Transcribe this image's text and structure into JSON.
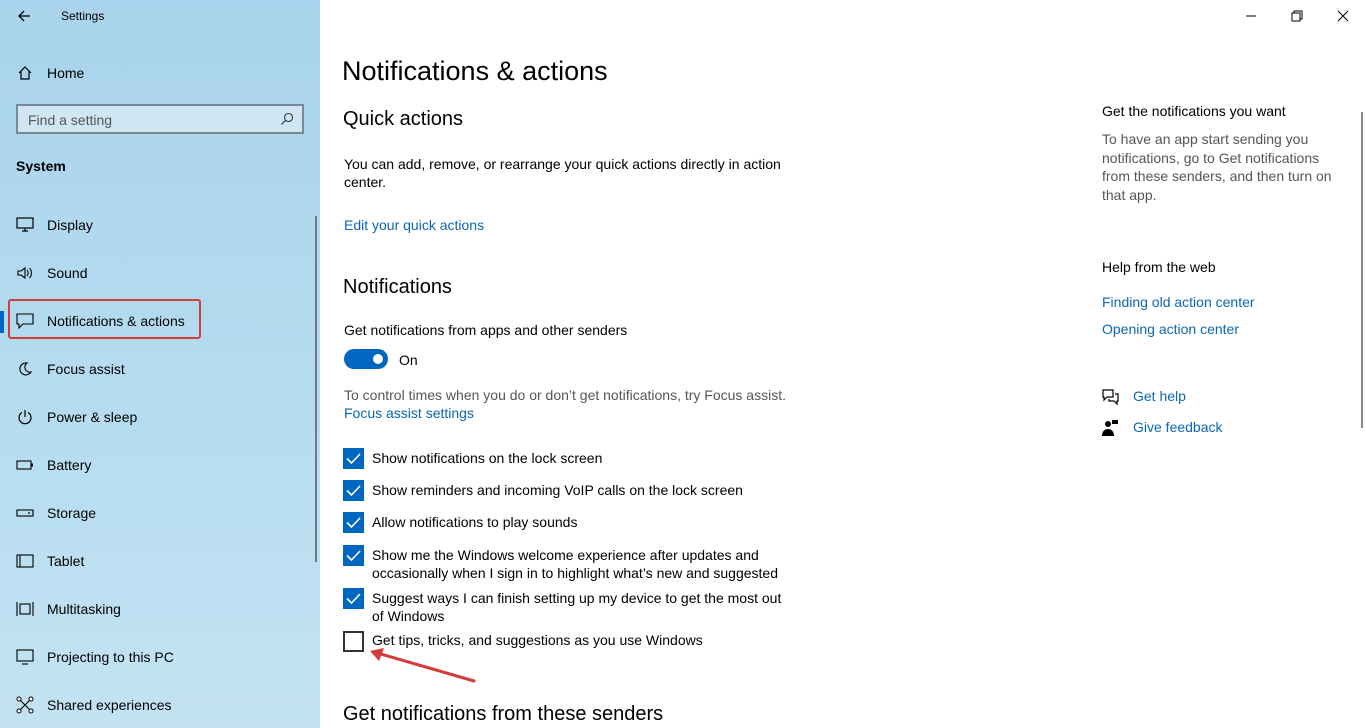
{
  "window": {
    "app_title": "Settings",
    "back_icon": "back-arrow-icon",
    "controls": [
      "minimize-icon",
      "restore-icon",
      "close-icon"
    ]
  },
  "sidebar": {
    "home_label": "Home",
    "search_placeholder": "Find a setting",
    "section_title": "System",
    "items": [
      {
        "label": "Display",
        "icon": "display-icon"
      },
      {
        "label": "Sound",
        "icon": "sound-icon"
      },
      {
        "label": "Notifications & actions",
        "icon": "notification-icon",
        "active": true
      },
      {
        "label": "Focus assist",
        "icon": "moon-icon"
      },
      {
        "label": "Power & sleep",
        "icon": "power-icon"
      },
      {
        "label": "Battery",
        "icon": "battery-icon"
      },
      {
        "label": "Storage",
        "icon": "storage-icon"
      },
      {
        "label": "Tablet",
        "icon": "tablet-icon"
      },
      {
        "label": "Multitasking",
        "icon": "multitasking-icon"
      },
      {
        "label": "Projecting to this PC",
        "icon": "projecting-icon"
      },
      {
        "label": "Shared experiences",
        "icon": "shared-icon"
      }
    ]
  },
  "main": {
    "title": "Notifications & actions",
    "quick_actions": {
      "heading": "Quick actions",
      "description": "You can add, remove, or rearrange your quick actions directly in action center.",
      "link": "Edit your quick actions"
    },
    "notifications": {
      "heading": "Notifications",
      "toggle_caption": "Get notifications from apps and other senders",
      "toggle_state": "On",
      "toggle_on": true,
      "focus_text": "To control times when you do or don’t get notifications, try Focus assist.",
      "focus_link": "Focus assist settings",
      "checkboxes": [
        {
          "label": "Show notifications on the lock screen",
          "checked": true
        },
        {
          "label": "Show reminders and incoming VoIP calls on the lock screen",
          "checked": true
        },
        {
          "label": "Allow notifications to play sounds",
          "checked": true
        },
        {
          "label": "Show me the Windows welcome experience after updates and occasionally when I sign in to highlight what’s new and suggested",
          "checked": true
        },
        {
          "label": "Suggest ways I can finish setting up my device to get the most out of Windows",
          "checked": true
        },
        {
          "label": "Get tips, tricks, and suggestions as you use Windows",
          "checked": false
        }
      ]
    },
    "senders_heading": "Get notifications from these senders"
  },
  "right": {
    "get_heading": "Get the notifications you want",
    "get_text": "To have an app start sending you notifications, go to Get notifications from these senders, and then turn on that app.",
    "help_heading": "Help from the web",
    "help_links": [
      "Finding old action center",
      "Opening action center"
    ],
    "get_help": "Get help",
    "give_feedback": "Give feedback"
  },
  "colors": {
    "accent": "#0067c0",
    "link": "#0b66b3",
    "annotation_red": "#d23c3c"
  }
}
